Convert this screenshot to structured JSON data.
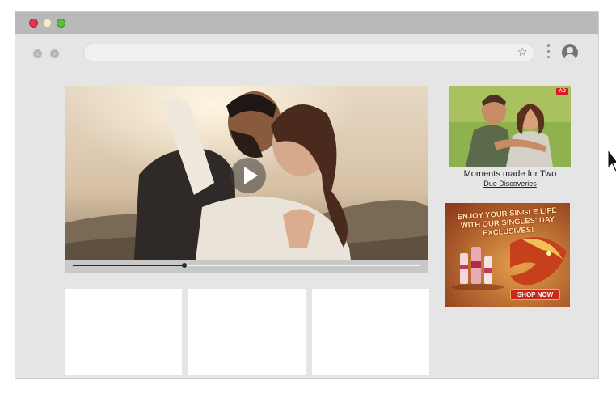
{
  "browser": {
    "nav_back_icon": "chevron-left-icon",
    "nav_forward_icon": "chevron-right-icon",
    "bookmark_icon": "star-outline-icon",
    "menu_icon": "vertical-dots-icon",
    "profile_icon": "account-circle-icon",
    "address_value": "",
    "back_glyph": "‹",
    "forward_glyph": "›",
    "star_glyph": "☆"
  },
  "video": {
    "play_icon": "play-icon",
    "progress_fraction": 0.32
  },
  "ads": {
    "ad1": {
      "badge": "AD",
      "title": "Moments made for Two",
      "link": "Due Discoveries"
    },
    "ad2": {
      "headline": "ENJOY YOUR SINGLE LIFE WITH OUR SINGLES' DAY EXCLUSIVES!",
      "cta": "SHOP NOW"
    }
  },
  "colors": {
    "window_bg": "#e5e5e5",
    "titlebar": "#b9b9b9",
    "progress_fill": "#1f2a44",
    "ad_badge": "#cf2027"
  }
}
